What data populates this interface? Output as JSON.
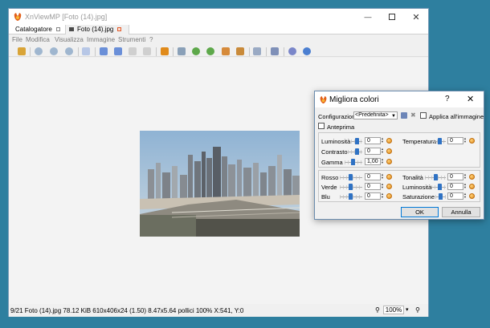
{
  "window": {
    "title": "XnViewMP [Foto (14).jpg]"
  },
  "tabs": [
    {
      "label": "Catalogatore"
    },
    {
      "label": "Foto (14).jpg"
    }
  ],
  "menu": [
    "File",
    "Modifica",
    "Visualizza",
    "Immagine",
    "Strumenti",
    "?"
  ],
  "status": {
    "text": "9/21 Foto (14).jpg 78.12 KiB 610x406x24 (1.50) 8.47x5.64 pollici 100% X:541, Y:0",
    "zoom": "100%"
  },
  "dialog": {
    "title": "Migliora colori",
    "help": "?",
    "config_label": "Configurazioni:",
    "config_value": "<Predefinita>",
    "apply_label": "Applica all'immagine",
    "preview_label": "Anteprima",
    "group1_left": [
      {
        "label": "Luminosità",
        "value": "0",
        "level": 0.5
      },
      {
        "label": "Contrasto",
        "value": "0",
        "level": 0.5
      },
      {
        "label": "Gamma",
        "value": "1,00",
        "level": 0.5
      }
    ],
    "group1_right": [
      {
        "label": "Temperatura",
        "value": "0",
        "level": 0.5
      }
    ],
    "group2_left": [
      {
        "label": "Rosso",
        "value": "0",
        "level": 0.5
      },
      {
        "label": "Verde",
        "value": "0",
        "level": 0.5
      },
      {
        "label": "Blu",
        "value": "0",
        "level": 0.5
      }
    ],
    "group2_right": [
      {
        "label": "Tonalità",
        "value": "0",
        "level": 0.5
      },
      {
        "label": "Luminosità",
        "value": "0",
        "level": 0.5
      },
      {
        "label": "Saturazione",
        "value": "0",
        "level": 0.5
      }
    ],
    "ok": "OK",
    "cancel": "Annulla"
  },
  "colors": {
    "desktop": "#2e7f9f",
    "accent": "#2f72c4"
  }
}
